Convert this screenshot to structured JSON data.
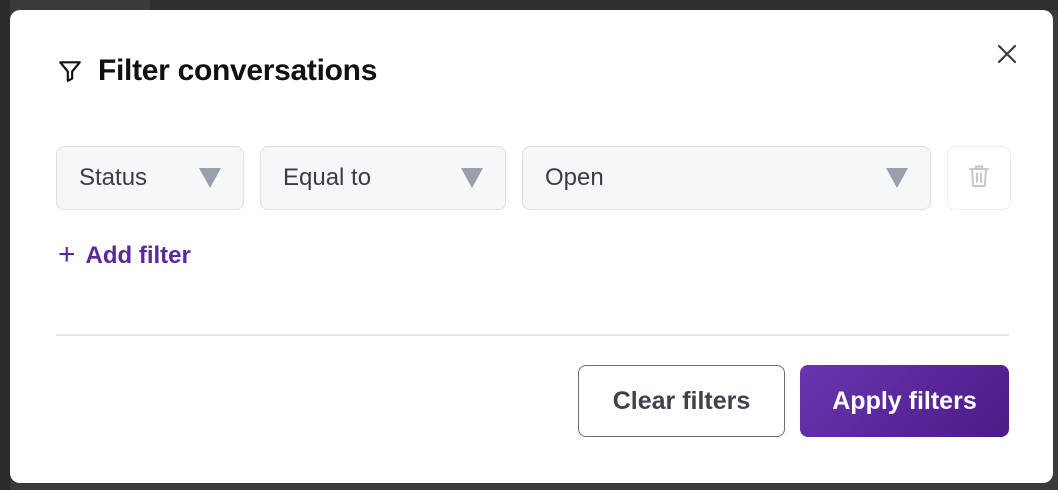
{
  "modal": {
    "title": "Filter conversations",
    "icons": {
      "title_icon": "filter-icon",
      "close_icon": "close-icon",
      "delete_icon": "trash-icon"
    }
  },
  "filters": [
    {
      "attribute": "Status",
      "operator": "Equal to",
      "value": "Open"
    }
  ],
  "actions": {
    "add_filter_plus": "+",
    "add_filter_label": "Add filter",
    "clear_label": "Clear filters",
    "apply_label": "Apply filters"
  },
  "colors": {
    "accent": "#5b2a99",
    "apply_start": "#6a35b0",
    "apply_end": "#4b1b86"
  }
}
